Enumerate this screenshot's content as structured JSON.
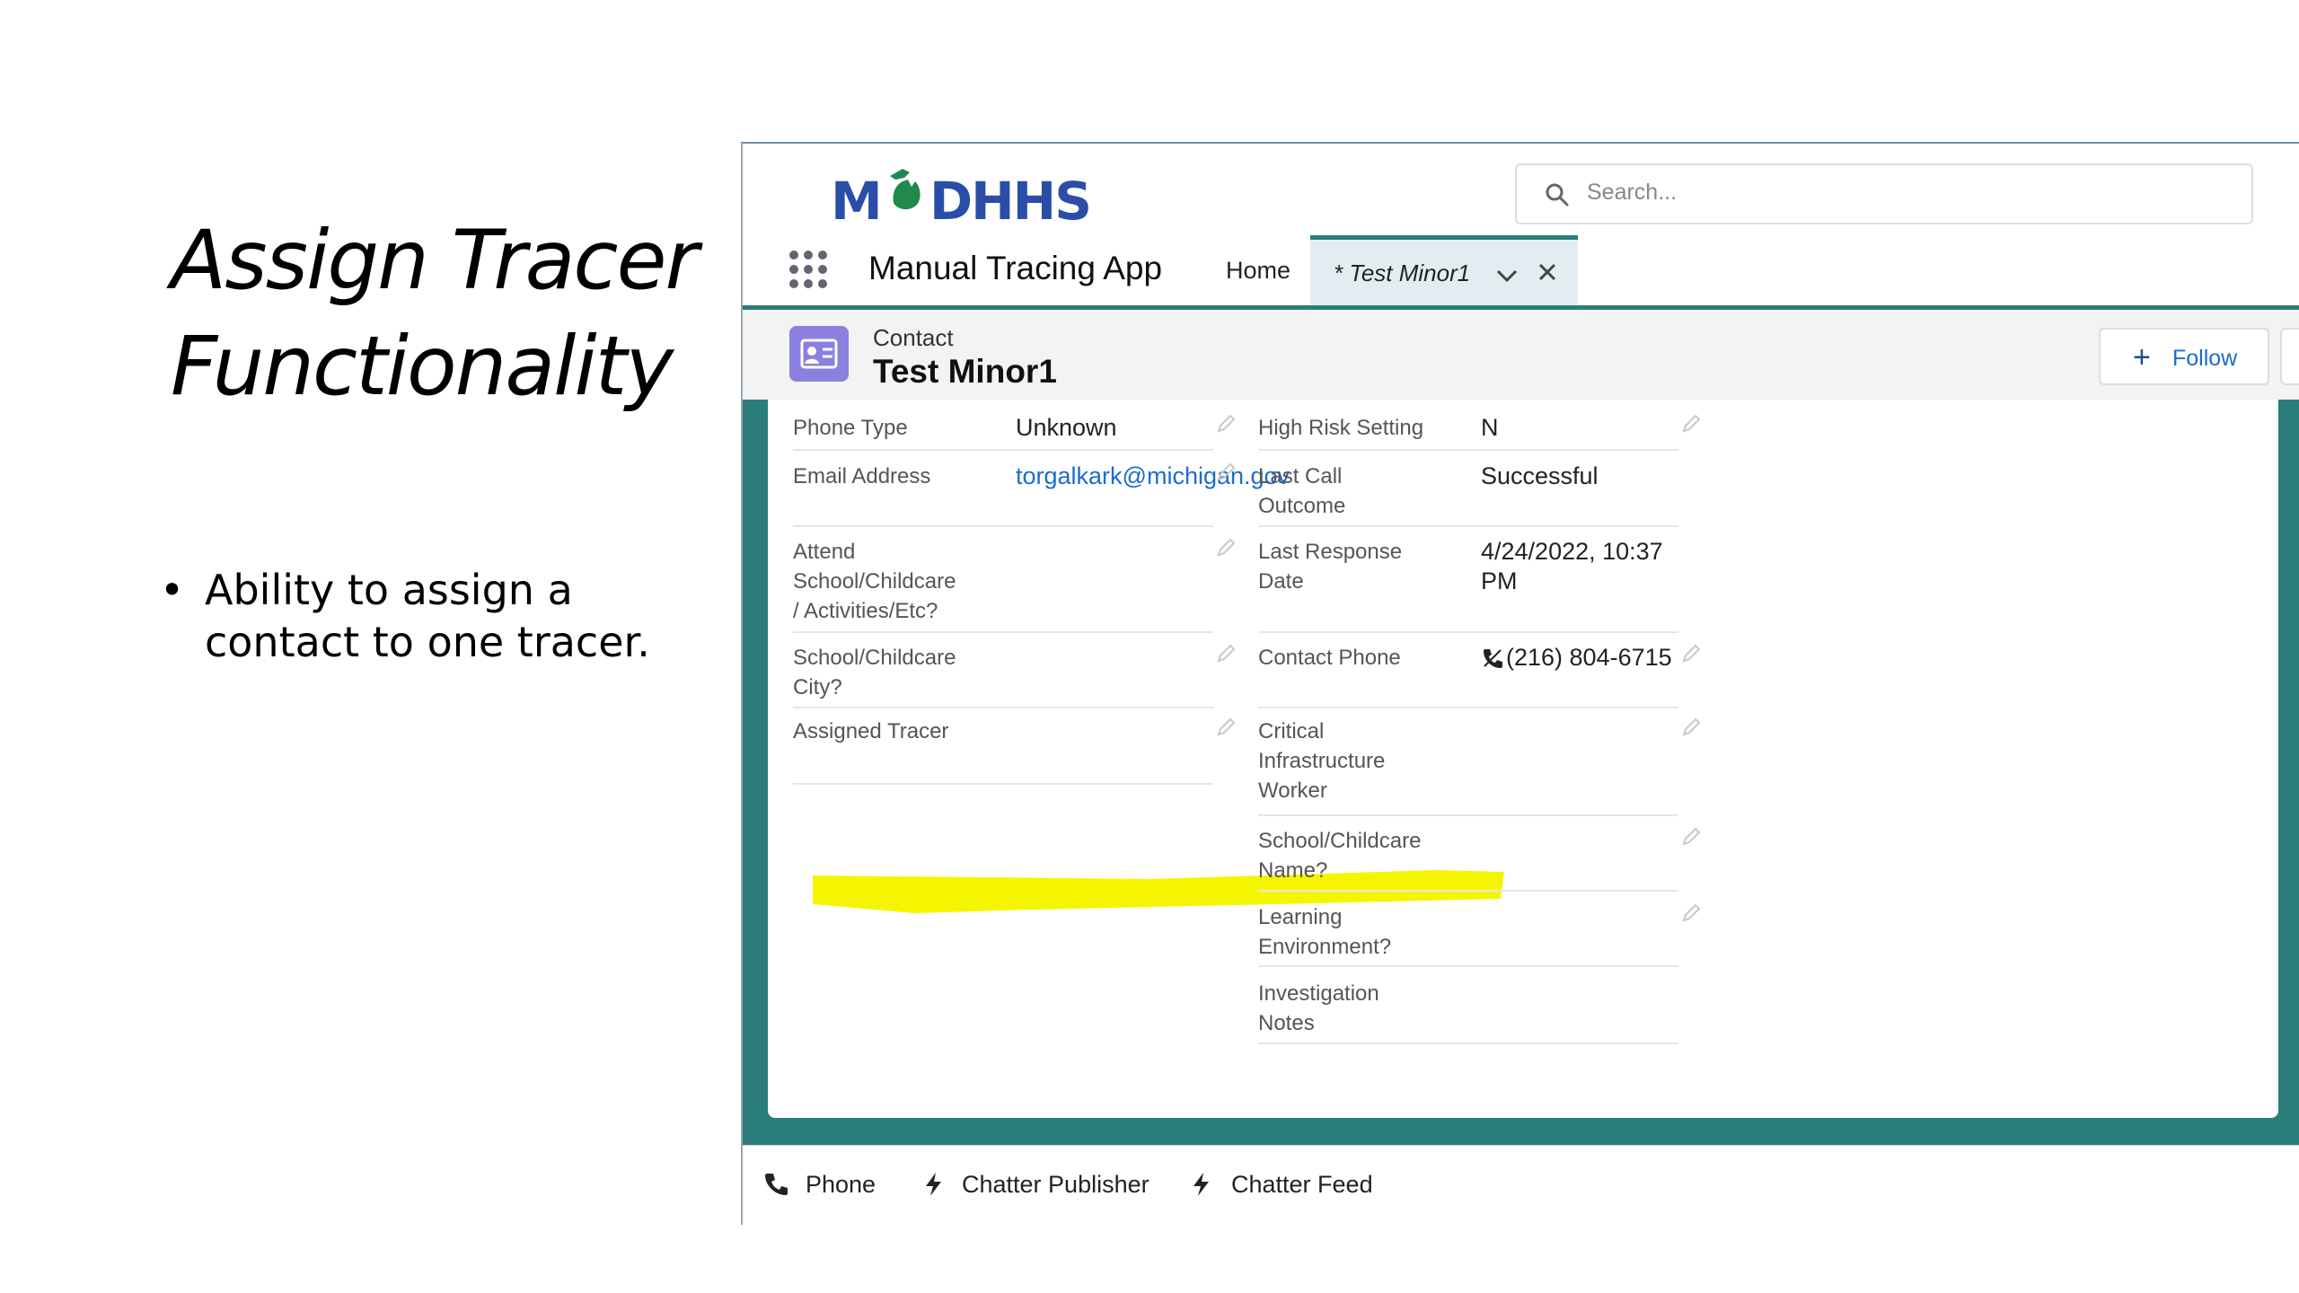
{
  "slide": {
    "title_line1": "Assign Tracer",
    "title_line2": "Functionality",
    "bullet_marker": "•",
    "bullet": "Ability to assign a contact to one tracer."
  },
  "app": {
    "logo_text": "MDHHS",
    "logo_colors": {
      "blue": "#2a4ea8",
      "green": "#1f8a4c"
    },
    "search_placeholder": "Search...",
    "app_name": "Manual Tracing App",
    "tabs": [
      {
        "label": "Home"
      },
      {
        "label": "* Test Minor1",
        "active": true
      }
    ],
    "accent": "#2a7d79"
  },
  "record": {
    "object_label": "Contact",
    "name": "Test Minor1",
    "follow_label": "Follow",
    "icon_color": "#8b7fe0"
  },
  "left_fields": [
    {
      "label": "Phone Type",
      "value": "Unknown"
    },
    {
      "label": "Email Address",
      "value": "torgalkark@michigan.gov"
    },
    {
      "label": "Attend School/Childcare / Activities/Etc?",
      "value": ""
    },
    {
      "label": "School/Childcare City?",
      "value": ""
    },
    {
      "label": "Assigned Tracer",
      "value": ""
    }
  ],
  "right_fields": [
    {
      "label": "High Risk Setting",
      "value": "N"
    },
    {
      "label": "Last Call Outcome",
      "value": "Successful"
    },
    {
      "label": "Last Response Date",
      "value": "4/24/2022, 10:37 PM"
    },
    {
      "label": "Contact Phone",
      "value": "(216) 804-6715"
    },
    {
      "label": "Critical Infrastructure Worker",
      "value": ""
    },
    {
      "label": "School/Childcare Name?",
      "value": ""
    },
    {
      "label": "Learning Environment?",
      "value": ""
    },
    {
      "label": "Investigation Notes",
      "value": ""
    }
  ],
  "highlight_color": "#f5f500",
  "footer": [
    {
      "label": "Phone",
      "icon": "phone-icon"
    },
    {
      "label": "Chatter Publisher",
      "icon": "bolt-icon"
    },
    {
      "label": "Chatter Feed",
      "icon": "bolt-icon"
    }
  ]
}
